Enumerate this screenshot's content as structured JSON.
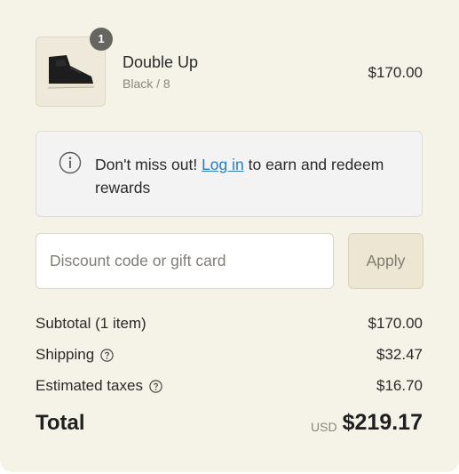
{
  "product": {
    "name": "Double Up",
    "variant": "Black / 8",
    "price": "$170.00",
    "quantity": "1",
    "thumbnail_icon": "sneaker-thumbnail"
  },
  "notice": {
    "icon": "info-icon",
    "text_before": "Don't miss out! ",
    "link": "Log in",
    "text_after": " to earn and redeem rewards"
  },
  "discount": {
    "placeholder": "Discount code or gift card",
    "value": "",
    "apply_label": "Apply"
  },
  "summary": {
    "subtotal_label": "Subtotal (1 item)",
    "subtotal_value": "$170.00",
    "shipping_label": "Shipping",
    "shipping_value": "$32.47",
    "taxes_label": "Estimated taxes",
    "taxes_value": "$16.70",
    "help_icon": "question-circle-icon"
  },
  "total": {
    "label": "Total",
    "currency": "USD",
    "value": "$219.17"
  },
  "colors": {
    "panel_bg": "#f5f2e7",
    "link": "#2c7bb6",
    "apply_bg": "#ece6d3",
    "badge": "#666560"
  }
}
